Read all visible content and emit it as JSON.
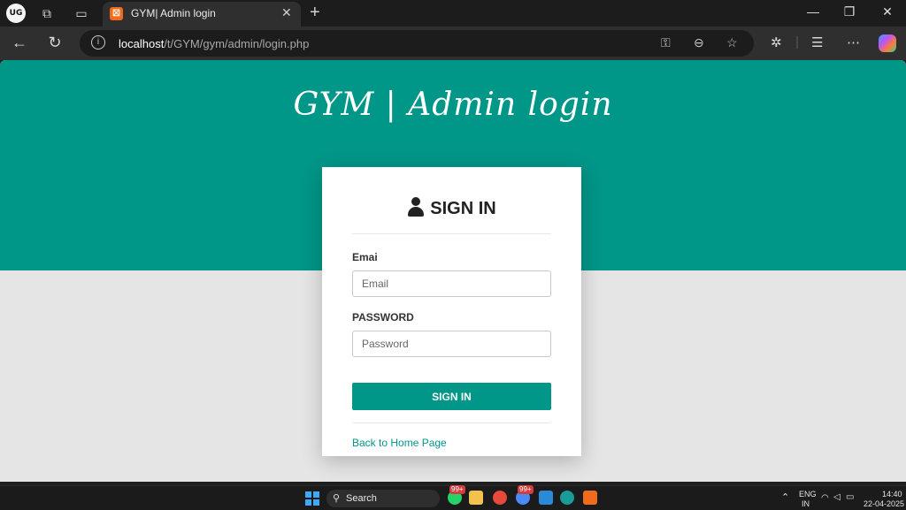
{
  "browser": {
    "profile_initials": "UG",
    "tab_title": "GYM| Admin login",
    "url_host": "localhost",
    "url_path": "/t/GYM/gym/admin/login.php"
  },
  "page": {
    "title": "GYM | Admin login",
    "form": {
      "heading": "SIGN IN",
      "email_label": "Emai",
      "email_placeholder": "Email",
      "password_label": "PASSWORD",
      "password_placeholder": "Password",
      "submit_label": "SIGN IN",
      "home_link": "Back to Home Page"
    }
  },
  "colors": {
    "accent": "#009688",
    "background": "#e5e5e5"
  },
  "taskbar": {
    "search_label": "Search",
    "badge_count_1": "99+",
    "badge_count_2": "99+",
    "language": "ENG",
    "region": "IN",
    "time": "14:40",
    "date": "22-04-2025"
  }
}
